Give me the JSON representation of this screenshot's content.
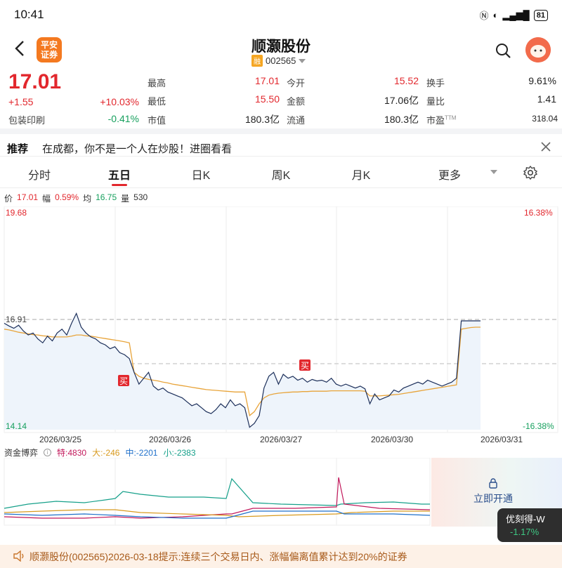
{
  "status_bar": {
    "time": "10:41",
    "battery": "81"
  },
  "header": {
    "broker_logo_text": "平安证券",
    "stock_name": "顺灏股份",
    "margin_badge": "融",
    "stock_code": "002565"
  },
  "quote": {
    "price": "17.01",
    "change": "+1.55",
    "change_pct": "+10.03%",
    "sector": "包装印刷",
    "sector_pct": "-0.41%",
    "fields": [
      {
        "label": "最高",
        "value": "17.01"
      },
      {
        "label": "今开",
        "value": "15.52"
      },
      {
        "label": "换手",
        "value": "9.61%"
      },
      {
        "label": "最低",
        "value": "15.50"
      },
      {
        "label": "金额",
        "value": "17.06亿"
      },
      {
        "label": "量比",
        "value": "1.41"
      },
      {
        "label": "市值",
        "value": "180.3亿"
      },
      {
        "label": "流通",
        "value": "180.3亿"
      },
      {
        "label": "市盈",
        "label_sup": "TTM",
        "value": "318.04"
      }
    ]
  },
  "recommend": {
    "title": "推荐",
    "text": "在成都，你不是一个人在炒股！进圈看看"
  },
  "tabs": [
    "分时",
    "五日",
    "日K",
    "周K",
    "月K",
    "更多"
  ],
  "info_line": {
    "price_label": "价",
    "price": "17.01",
    "range_label": "幅",
    "range": "0.59%",
    "avg_label": "均",
    "avg": "16.75",
    "vol_label": "量",
    "vol": "530"
  },
  "chart_data": {
    "type": "line",
    "y_axis": {
      "max_label": "19.68",
      "min_label": "14.14",
      "ref_label": "16.91",
      "max": 19.68,
      "min": 14.14,
      "ref": 16.91
    },
    "right_axis": {
      "top": "16.38%",
      "bottom": "-16.38%"
    },
    "dates": [
      "2026/03/25",
      "2026/03/26",
      "2026/03/27",
      "2026/03/30",
      "2026/03/31"
    ],
    "buy_marker": "买",
    "series": [
      {
        "key": "price",
        "values": [
          16.85,
          16.78,
          16.72,
          16.8,
          16.65,
          16.55,
          16.6,
          16.45,
          16.35,
          16.52,
          16.4,
          16.6,
          16.7,
          16.55,
          16.85,
          17.1,
          16.75,
          16.6,
          16.5,
          16.45,
          16.35,
          16.3,
          16.2,
          16.25,
          16.1,
          16.05,
          15.95,
          15.6,
          15.3,
          15.45,
          15.6,
          15.25,
          15.15,
          15.2,
          15.1,
          15.05,
          15.0,
          14.95,
          14.85,
          14.75,
          14.8,
          14.7,
          14.6,
          14.55,
          14.65,
          14.8,
          14.7,
          14.9,
          14.75,
          14.8,
          14.7,
          14.2,
          14.3,
          14.5,
          15.2,
          15.5,
          15.6,
          15.3,
          15.55,
          15.45,
          15.5,
          15.4,
          15.45,
          15.35,
          15.42,
          15.38,
          15.4,
          15.35,
          15.45,
          15.3,
          15.25,
          15.3,
          15.25,
          15.2,
          15.25,
          15.18,
          14.8,
          15.05,
          14.9,
          14.95,
          15.0,
          15.15,
          15.1,
          15.2,
          15.25,
          15.3,
          15.35,
          15.3,
          15.4,
          15.35,
          15.3,
          15.25,
          15.3,
          15.35,
          15.45,
          16.91,
          16.91,
          16.91,
          16.91,
          16.91
        ]
      },
      {
        "key": "avg",
        "values": [
          16.7,
          16.68,
          16.65,
          16.62,
          16.6,
          16.58,
          16.56,
          16.55,
          16.53,
          16.52,
          16.5,
          16.5,
          16.5,
          16.5,
          16.52,
          16.55,
          16.55,
          16.53,
          16.52,
          16.5,
          16.48,
          16.46,
          16.44,
          16.42,
          16.4,
          16.38,
          16.35,
          15.6,
          15.5,
          15.45,
          15.42,
          15.4,
          15.38,
          15.35,
          15.33,
          15.3,
          15.28,
          15.26,
          15.24,
          15.22,
          15.2,
          15.18,
          15.16,
          15.15,
          15.14,
          15.13,
          15.12,
          15.11,
          15.1,
          15.1,
          15.1,
          14.5,
          14.6,
          14.8,
          14.95,
          15.02,
          15.05,
          15.07,
          15.08,
          15.09,
          15.1,
          15.1,
          15.11,
          15.11,
          15.12,
          15.12,
          15.12,
          15.12,
          15.13,
          15.13,
          15.13,
          15.13,
          15.13,
          15.13,
          15.13,
          15.12,
          15.0,
          15.0,
          15.0,
          15.01,
          15.02,
          15.03,
          15.04,
          15.06,
          15.08,
          15.1,
          15.12,
          15.14,
          15.16,
          15.18,
          15.2,
          15.22,
          15.24,
          15.26,
          15.28,
          16.7,
          16.72,
          16.74,
          16.75,
          16.75
        ]
      }
    ]
  },
  "fund_flow": {
    "title": "资金博弈",
    "special_label": "特:",
    "special": "4830",
    "large_label": "大:",
    "large": "-246",
    "mid_label": "中:",
    "mid": "-2201",
    "small_label": "小:",
    "small": "-2383"
  },
  "unlock": {
    "text": "立即开通"
  },
  "floating_stock": {
    "name": "优刻得-W",
    "pct": "-1.17%"
  },
  "notice": {
    "text": "顺灏股份(002565)2026-03-18提示:连续三个交易日内、涨幅偏离值累计达到20%的证券"
  },
  "colors": {
    "up": "#e2272d",
    "down": "#17a05e",
    "price_line": "#1c2f5a",
    "avg_line": "#e8a43a"
  }
}
